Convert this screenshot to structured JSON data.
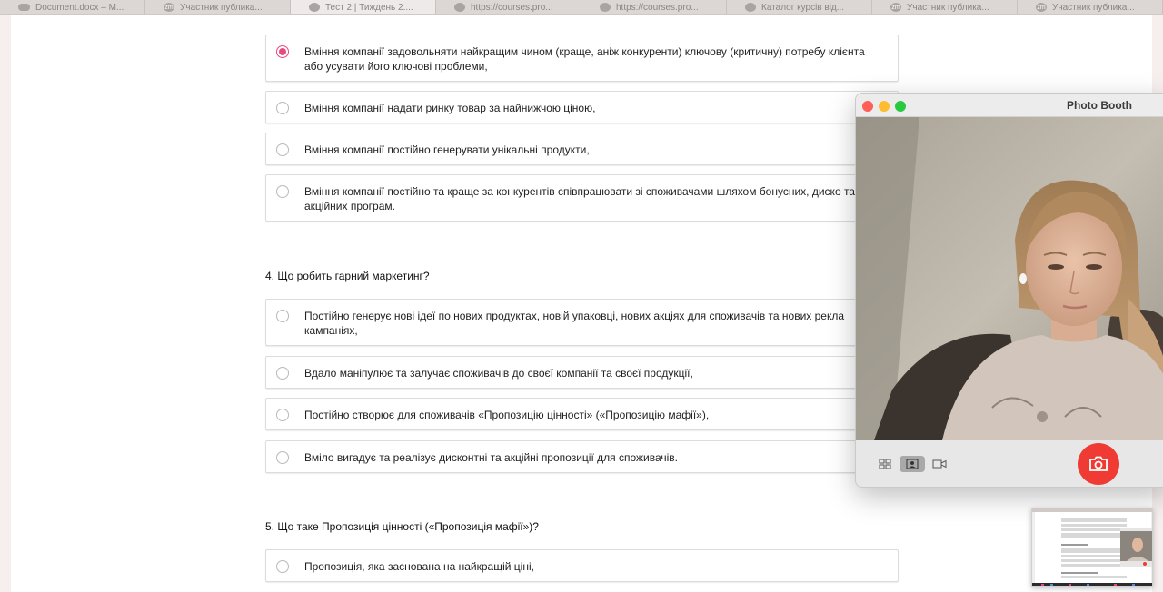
{
  "tabs": [
    {
      "label": "Document.docx – M...",
      "icon": "cloud-icon",
      "active": false
    },
    {
      "label": "Участник публика...",
      "icon": "zoom-icon",
      "active": false
    },
    {
      "label": "Тест 2 | Тиждень 2....",
      "icon": "course-icon",
      "active": true
    },
    {
      "label": "https://courses.pro...",
      "icon": "course-icon",
      "active": false
    },
    {
      "label": "https://courses.pro...",
      "icon": "course-icon",
      "active": false
    },
    {
      "label": "Каталог курсів від...",
      "icon": "course-icon",
      "active": false
    },
    {
      "label": "Участник публика...",
      "icon": "zoom-icon",
      "active": false
    },
    {
      "label": "Участник публика...",
      "icon": "zoom-icon",
      "active": false
    }
  ],
  "tab_icon_text": {
    "zoom": "zm"
  },
  "q3": {
    "options": [
      {
        "text": "Вміння компанії задовольняти найкращим чином (краще, аніж конкуренти) ключову (критичну) потребу клієнта або усувати його ключові проблеми,",
        "checked": true
      },
      {
        "text": "Вміння компанії надати ринку товар за найнижчою ціною,",
        "checked": false
      },
      {
        "text": "Вміння компанії постійно генерувати унікальні продукти,",
        "checked": false
      },
      {
        "text": "Вміння компанії постійно та краще за конкурентів співпрацювати зі споживачами шляхом бонусних, диско та акційних програм.",
        "checked": false
      }
    ]
  },
  "q4": {
    "title": "4. Що робить гарний маркетинг?",
    "options": [
      {
        "text": "Постійно генерує нові ідеї по нових продуктах, новій упаковці, нових акціях для споживачів та нових рекла кампаніях,",
        "checked": false
      },
      {
        "text": "Вдало маніпулює та залучає споживачів до своєї компанії та своєї продукції,",
        "checked": false
      },
      {
        "text": "Постійно створює для споживачів «Пропозицію цінності» («Пропозицію мафії»),",
        "checked": false
      },
      {
        "text": "Вміло вигадує та реалізує дисконтні та акційні пропозиції для споживачів.",
        "checked": false
      }
    ]
  },
  "q5": {
    "title": "5. Що таке Пропозиція цінності («Пропозиція мафії»)?",
    "options": [
      {
        "text": "Пропозиція, яка заснована на найкращій ціні,",
        "checked": false
      }
    ]
  },
  "photo_booth": {
    "title": "Photo Booth",
    "modes": [
      {
        "icon": "grid-icon",
        "selected": false
      },
      {
        "icon": "portrait-icon",
        "selected": true
      },
      {
        "icon": "video-icon",
        "selected": false
      }
    ],
    "shutter_icon": "camera-icon"
  },
  "colors": {
    "accent_radio": "#e84a7f",
    "shutter": "#ef3b33",
    "traffic_red": "#fe5f57",
    "traffic_yellow": "#febc2e",
    "traffic_green": "#28c840"
  }
}
